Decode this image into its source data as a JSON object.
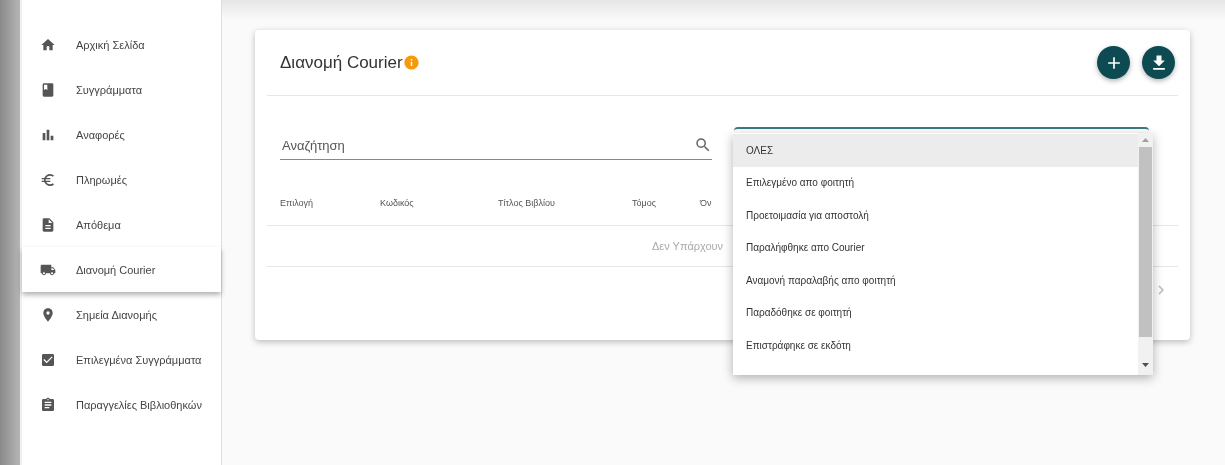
{
  "sidebar": {
    "items": [
      {
        "label": "Αρχική Σελίδα",
        "selected": false
      },
      {
        "label": "Συγγράμματα",
        "selected": false
      },
      {
        "label": "Αναφορές",
        "selected": false
      },
      {
        "label": "Πληρωμές",
        "selected": false
      },
      {
        "label": "Απόθεμα",
        "selected": false
      },
      {
        "label": "Διανομή Courier",
        "selected": true
      },
      {
        "label": "Σημεία Διανομής",
        "selected": false
      },
      {
        "label": "Επιλεγμένα Συγγράμματα",
        "selected": false
      },
      {
        "label": "Παραγγελίες Βιβλιοθηκών",
        "selected": false
      }
    ]
  },
  "card": {
    "title": "Διανομή Courier",
    "search": {
      "placeholder": "Αναζήτηση"
    },
    "table": {
      "columns": [
        "Επιλογή",
        "Κωδικός",
        "Τίτλος Βιβλίου",
        "Τόμος",
        "Όν"
      ],
      "empty_message": "Δεν Υπάρχουν"
    },
    "status_menu": {
      "options": [
        {
          "label": "ΟΛΕΣ",
          "selected": true
        },
        {
          "label": "Επιλεγμένο απο φοιτητή",
          "selected": false
        },
        {
          "label": "Προετοιμασία για αποστολή",
          "selected": false
        },
        {
          "label": "Παραλήφθηκε απο Courier",
          "selected": false
        },
        {
          "label": "Αναμονή παραλαβής απο φοιτητή",
          "selected": false
        },
        {
          "label": "Παραδόθηκε σε φοιτητή",
          "selected": false
        },
        {
          "label": "Επιστράφηκε σε εκδότη",
          "selected": false
        }
      ]
    }
  }
}
